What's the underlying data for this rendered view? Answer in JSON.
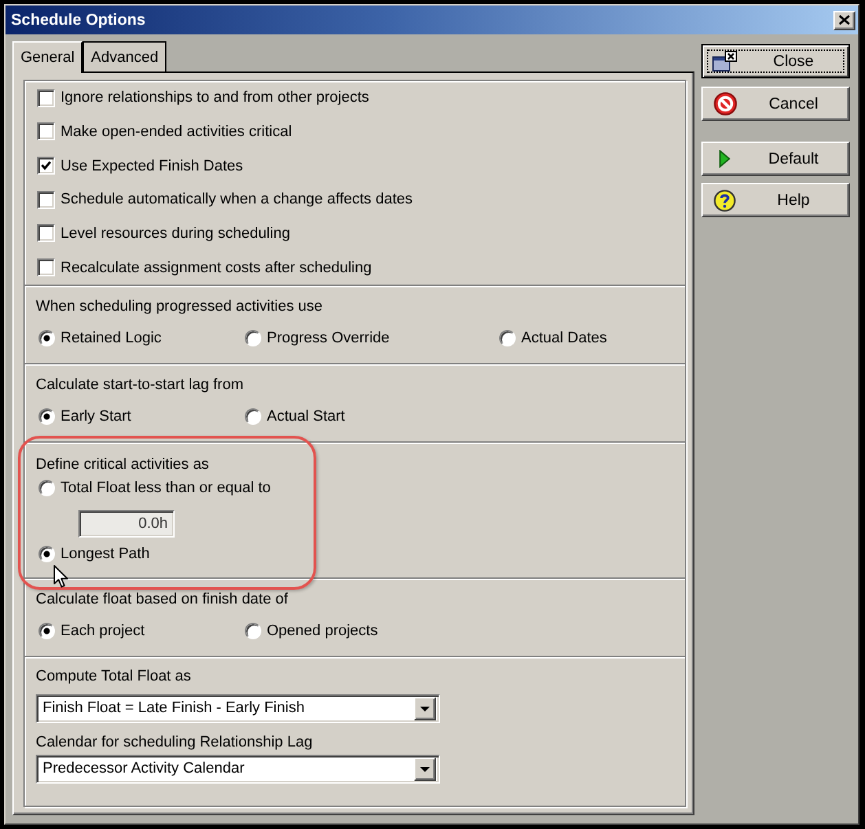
{
  "window": {
    "title": "Schedule Options"
  },
  "tabs": [
    {
      "label": "General",
      "selected": true
    },
    {
      "label": "Advanced",
      "selected": false
    }
  ],
  "sections": [
    {
      "kind": "checklist",
      "highlighted": false,
      "options": [
        {
          "label": "Ignore relationships to and from other projects",
          "checked": false
        },
        {
          "label": "Make open-ended activities critical",
          "checked": false
        },
        {
          "label": "Use Expected Finish Dates",
          "checked": true
        },
        {
          "label": "Schedule automatically when a change affects dates",
          "checked": false
        },
        {
          "label": "Level resources during scheduling",
          "checked": false
        },
        {
          "label": "Recalculate assignment costs after scheduling",
          "checked": false
        }
      ]
    },
    {
      "kind": "radiorow",
      "highlighted": false,
      "label": "When scheduling progressed activities use",
      "options": [
        {
          "label": "Retained Logic",
          "selected": true
        },
        {
          "label": "Progress Override",
          "selected": false
        },
        {
          "label": "Actual Dates",
          "selected": false
        }
      ]
    },
    {
      "kind": "radiorow",
      "highlighted": false,
      "label": "Calculate start-to-start lag from",
      "options": [
        {
          "label": "Early Start",
          "selected": true
        },
        {
          "label": "Actual Start",
          "selected": false
        }
      ]
    },
    {
      "kind": "radiocolumn",
      "highlighted": true,
      "label": "Define critical activities as",
      "options": [
        {
          "label": "Total Float less than or equal to",
          "selected": false,
          "field": {
            "value": "0.0h",
            "disabled": true
          }
        },
        {
          "label": "Longest Path",
          "selected": true
        }
      ]
    },
    {
      "kind": "radiorow",
      "highlighted": false,
      "label": "Calculate float based on finish date of",
      "options": [
        {
          "label": "Each project",
          "selected": true
        },
        {
          "label": "Opened projects",
          "selected": false
        }
      ]
    },
    {
      "kind": "dropdowns",
      "highlighted": false,
      "fields": [
        {
          "label": "Compute Total Float as",
          "value": "Finish Float = Late Finish - Early Finish"
        },
        {
          "label": "Calendar for scheduling Relationship Lag",
          "value": "Predecessor Activity Calendar"
        }
      ]
    }
  ],
  "buttons": [
    [
      {
        "kind": "close",
        "label": "Close",
        "focused": true
      },
      {
        "kind": "cancel",
        "label": "Cancel",
        "focused": false
      }
    ],
    [
      {
        "kind": "default",
        "label": "Default",
        "focused": false
      },
      {
        "kind": "help",
        "label": "Help",
        "focused": false
      }
    ]
  ]
}
